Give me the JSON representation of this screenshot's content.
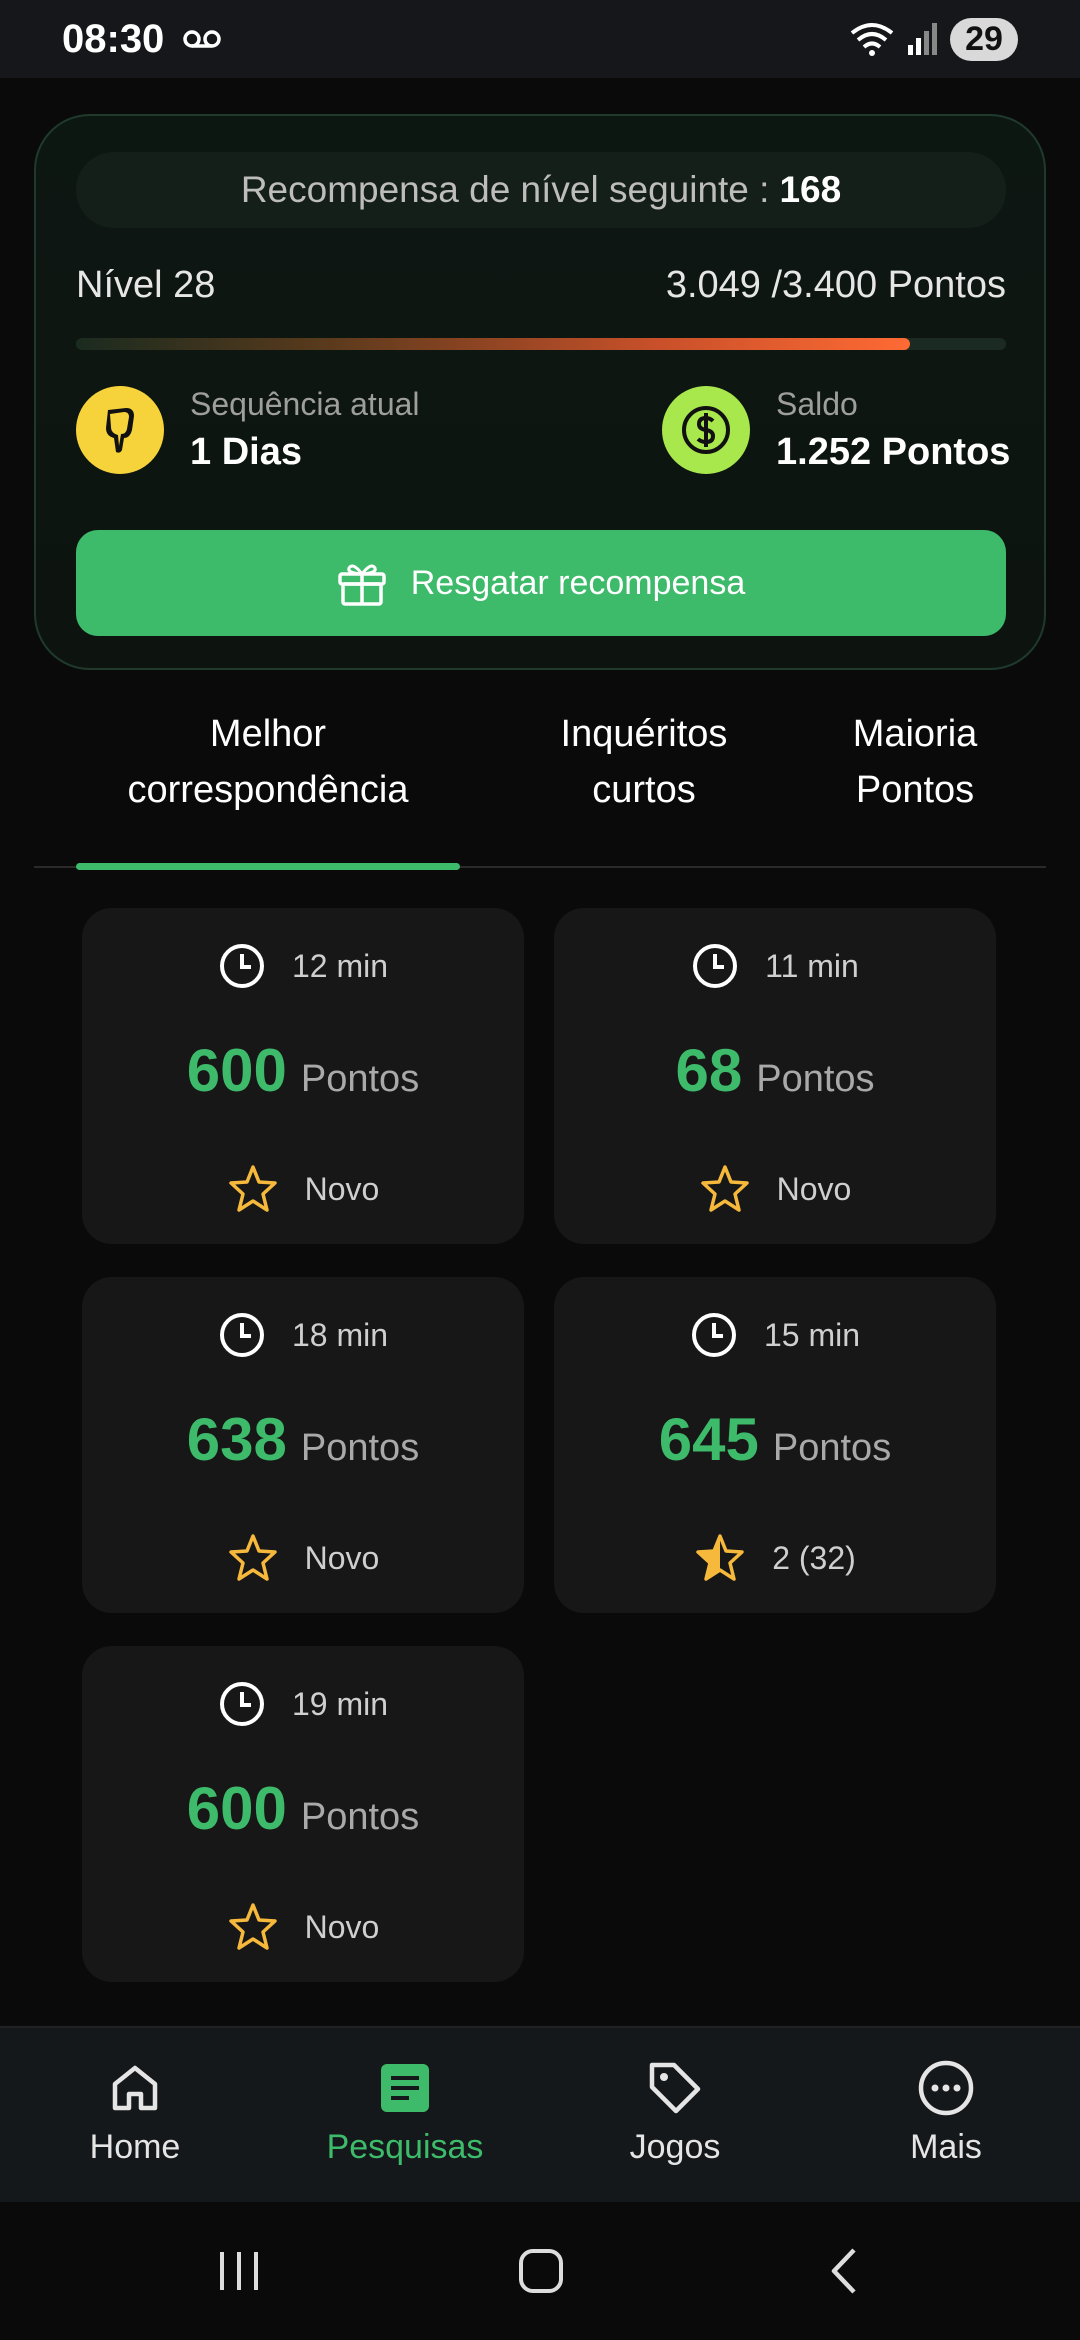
{
  "status_bar": {
    "time": "08:30",
    "battery": "29"
  },
  "progress_card": {
    "reward_label": "Recompensa de nível seguinte :",
    "reward_value": "168",
    "level": "Nível 28",
    "points_progress": "3.049 /3.400 Pontos",
    "progress_fraction": 0.897,
    "streak_label": "Sequência atual",
    "streak_value": "1 Dias",
    "balance_label": "Saldo",
    "balance_value": "1.252 Pontos",
    "redeem_label": "Resgatar recompensa"
  },
  "tabs": [
    {
      "line1": "Melhor",
      "line2": "correspondência"
    },
    {
      "line1": "Inquéritos",
      "line2": "curtos"
    },
    {
      "line1": "Maioria",
      "line2": "Pontos"
    }
  ],
  "surveys": [
    {
      "time": "12 min",
      "points": "600",
      "unit": "Pontos",
      "rating": "Novo"
    },
    {
      "time": "11 min",
      "points": "68",
      "unit": "Pontos",
      "rating": "Novo"
    },
    {
      "time": "18 min",
      "points": "638",
      "unit": "Pontos",
      "rating": "Novo"
    },
    {
      "time": "15 min",
      "points": "645",
      "unit": "Pontos",
      "rating": "2 (32)"
    },
    {
      "time": "19 min",
      "points": "600",
      "unit": "Pontos",
      "rating": "Novo"
    }
  ],
  "bottom_nav": [
    {
      "label": "Home",
      "icon": "home-icon"
    },
    {
      "label": "Pesquisas",
      "icon": "surveys-icon"
    },
    {
      "label": "Jogos",
      "icon": "tag-icon"
    },
    {
      "label": "Mais",
      "icon": "more-icon"
    }
  ],
  "colors": {
    "accent": "#3dba6a",
    "streak": "#f6d33a",
    "balance": "#a8e84d",
    "progress": "#ff6a34"
  }
}
